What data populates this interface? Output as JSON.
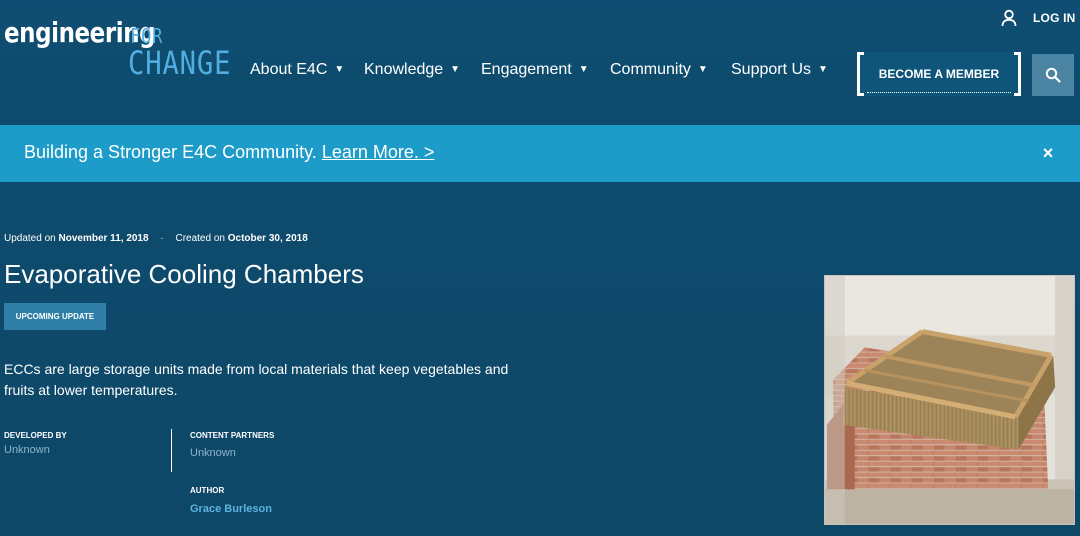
{
  "header": {
    "logo": {
      "main": "engineering",
      "for": "FOR",
      "change": "CHANGE"
    },
    "nav": [
      {
        "label": "About E4C"
      },
      {
        "label": "Knowledge"
      },
      {
        "label": "Engagement"
      },
      {
        "label": "Community"
      },
      {
        "label": "Support Us"
      }
    ],
    "login_label": "LOG IN",
    "become_member_label": "BECOME A MEMBER"
  },
  "banner": {
    "text": "Building a Stronger E4C Community.",
    "link": "Learn More. >",
    "close": "×"
  },
  "article": {
    "updated_prefix": "Updated on",
    "updated_date": "November 11, 2018",
    "separator": "·",
    "created_prefix": "Created on",
    "created_date": "October 30, 2018",
    "title": "Evaporative Cooling Chambers",
    "badge": "UPCOMING UPDATE",
    "description": "ECCs are large storage units made from local materials that keep vegetables and fruits at lower temperatures.",
    "developed_by_label": "DEVELOPED BY",
    "developed_by_value": "Unknown",
    "content_partners_label": "CONTENT PARTNERS",
    "content_partners_value": "Unknown",
    "author_label": "AUTHOR",
    "author_value": "Grace Burleson"
  },
  "icons": {
    "user": "user-icon",
    "search": "search-icon",
    "caret": "caret-down-icon",
    "close": "close-icon"
  },
  "colors": {
    "header_bg": "#0f4e72",
    "banner_bg": "#1e9cc9",
    "logo_accent": "#52aee1",
    "badge_bg": "#2f7fa8",
    "search_bg": "#4b83a3",
    "link_accent": "#5cb4e1"
  }
}
